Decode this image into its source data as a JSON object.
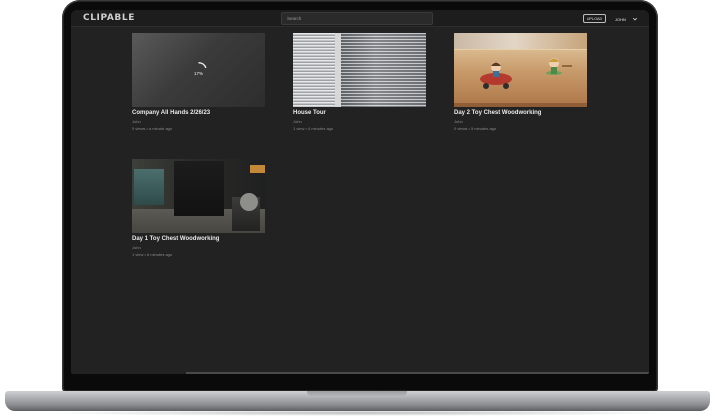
{
  "header": {
    "logo": "CLIPABLE",
    "search_placeholder": "Search",
    "upload_label": "UPLOAD",
    "user_label": "JOHN"
  },
  "videos": [
    {
      "title": "Company All Hands 2/26/23",
      "owner": "John",
      "views": "0 views",
      "age": "a minute ago",
      "processing_label": "17%",
      "processing_progress": 0.17
    },
    {
      "title": "House Tour",
      "owner": "John",
      "views": "1 view",
      "age": "4 minutes ago"
    },
    {
      "title": "Day 2 Toy Chest Woodworking",
      "owner": "John",
      "views": "0 views",
      "age": "5 minutes ago"
    },
    {
      "title": "Day 1 Toy Chest Woodworking",
      "owner": "John",
      "views": "1 view",
      "age": "6 minutes ago"
    }
  ],
  "meta_separator": "•",
  "icons": {
    "user_menu": "chevron-down-icon",
    "processing": "spinner-icon"
  },
  "colors": {
    "app_background": "#222222",
    "header_background": "#1d1d1d",
    "title_text": "#e9e9e9",
    "secondary_text": "#8a8a8a"
  }
}
